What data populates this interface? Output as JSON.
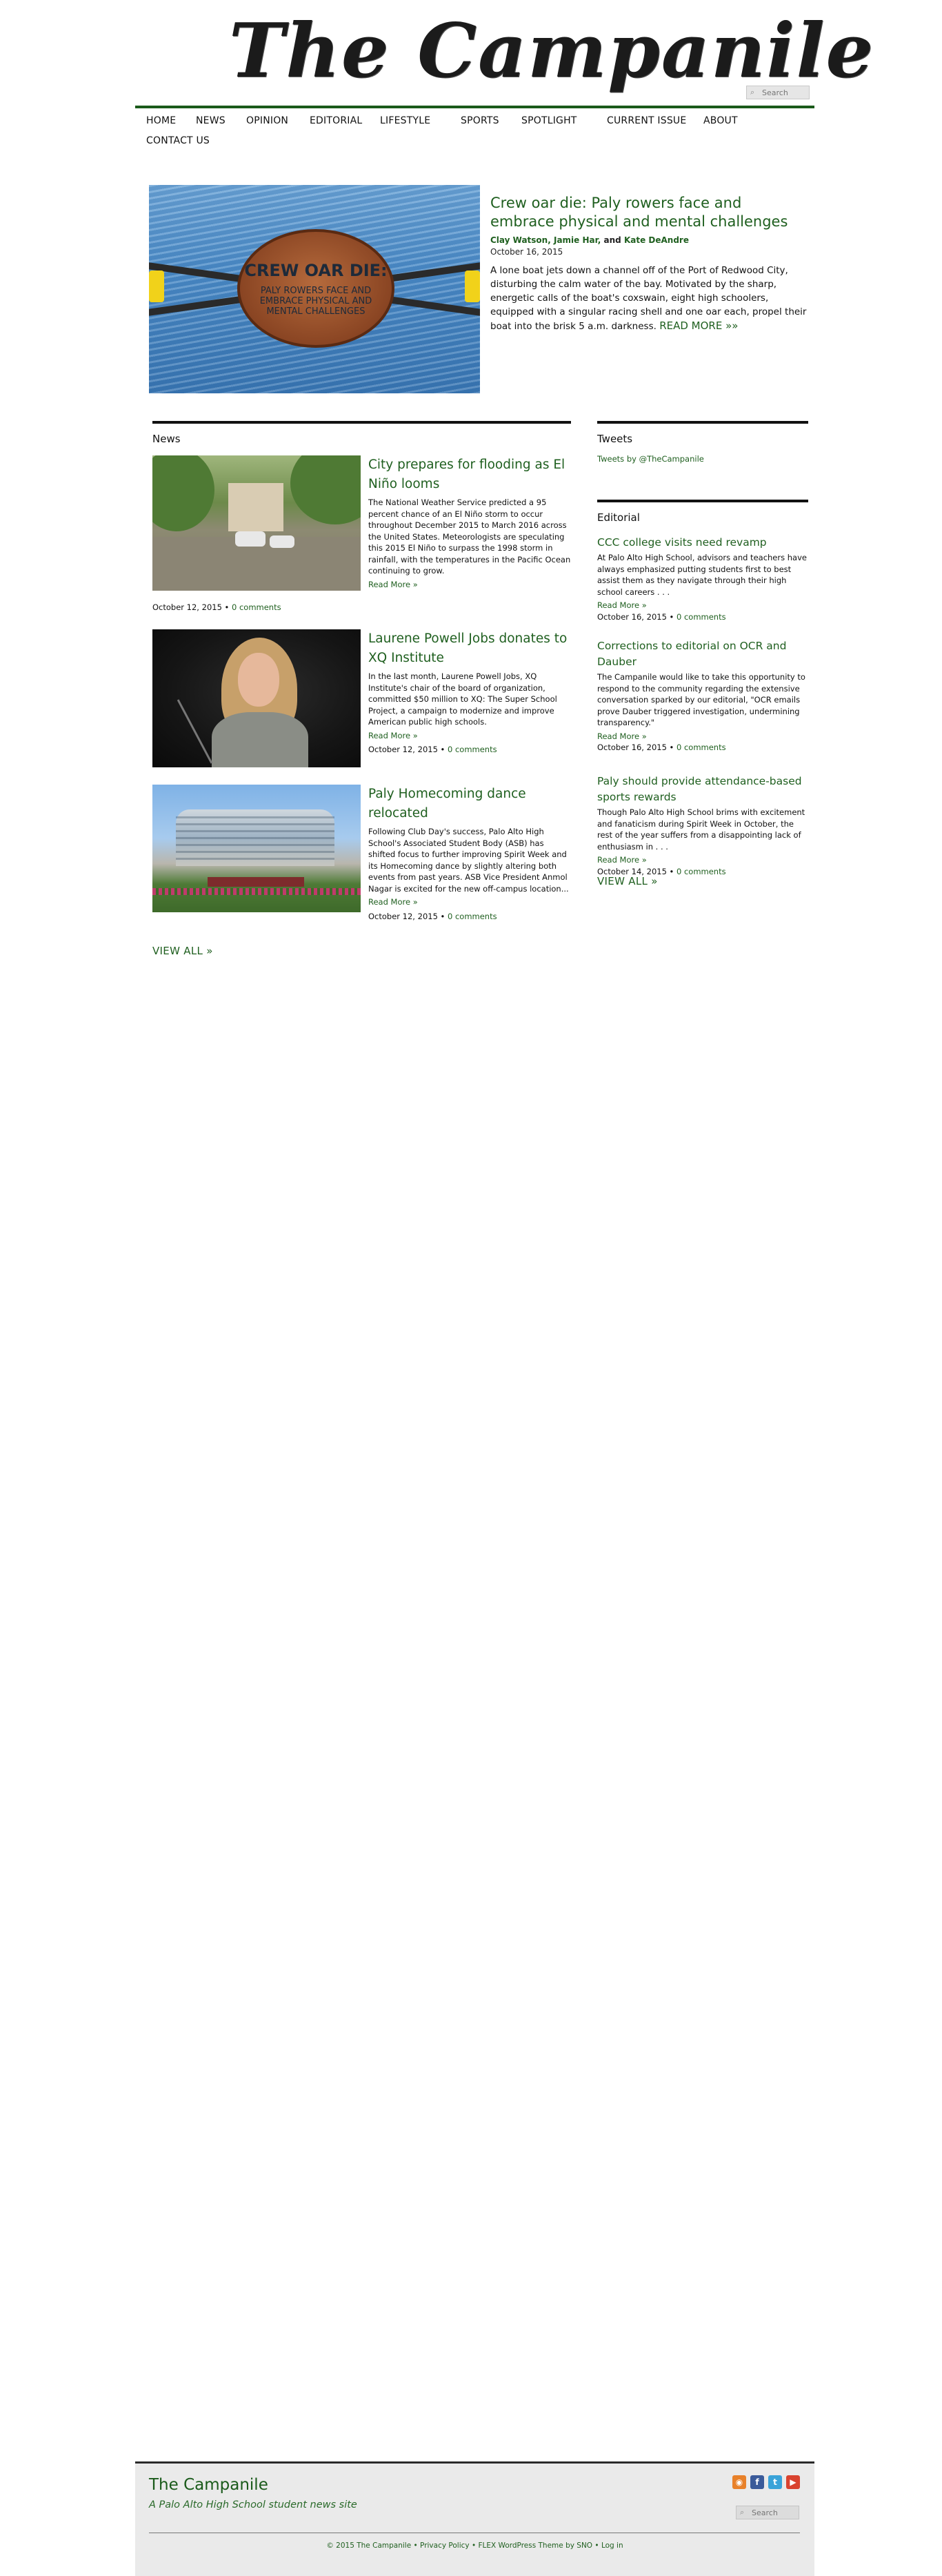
{
  "site": {
    "logo": "The Campanile",
    "search_placeholder": "Search"
  },
  "nav": {
    "items": [
      "HOME",
      "NEWS",
      "OPINION",
      "EDITORIAL",
      "LIFESTYLE",
      "SPORTS",
      "SPOTLIGHT",
      "CURRENT ISSUE",
      "ABOUT",
      "CONTACT US"
    ]
  },
  "feature": {
    "image_headline": "CREW OAR DIE:",
    "image_subhead": "PALY ROWERS FACE AND EMBRACE PHYSICAL AND MENTAL CHALLENGES",
    "title": "Crew oar die: Paly rowers face and embrace physical and mental challenges",
    "author1": "Clay Watson",
    "author2": "Jamie Har",
    "author_and": "and",
    "author3": "Kate DeAndre",
    "date": "October 16, 2015",
    "excerpt": "A lone boat jets down a channel off of the Port of Redwood City, disturbing the calm water of the bay. Motivated by the sharp, energetic calls of the boat's coxswain, eight high schoolers, equipped with a singular racing shell and one oar each, propel their boat into the brisk 5 a.m. darkness.",
    "read_more": "READ MORE »»"
  },
  "news": {
    "heading": "News",
    "items": [
      {
        "title": "City prepares for flooding as El Niño looms",
        "excerpt": "The National Weather Service predicted a 95 percent chance of an El Niño storm to occur throughout December 2015 to March 2016 across the United States. Meteorologists are speculating this 2015 El Niño to surpass the 1998 storm in rainfall, with the temperatures in the Pacific Ocean continuing to grow.",
        "read_more": "Read More »",
        "date": "October 12, 2015",
        "sep": "•",
        "comments": "0 comments"
      },
      {
        "title": "Laurene Powell Jobs donates to XQ Institute",
        "excerpt": "In the last month, Laurene Powell Jobs, XQ Institute's chair of the board of organization, committed $50 million to XQ: The Super School Project, a campaign to modernize and improve American public high schools.",
        "read_more": "Read More »",
        "date": "October 12, 2015",
        "sep": "•",
        "comments": "0 comments"
      },
      {
        "title": "Paly Homecoming dance relocated",
        "excerpt": "Following Club Day's success, Palo Alto High School's Associated Student Body (ASB) has shifted focus to further improving Spirit Week and its Homecoming dance by slightly altering both events from past years. ASB Vice President Anmol Nagar is excited for the new off-campus location...",
        "read_more": "Read More »",
        "date": "October 12, 2015",
        "sep": "•",
        "comments": "0 comments"
      }
    ],
    "view_all": "VIEW ALL »"
  },
  "tweets": {
    "heading": "Tweets",
    "link": "Tweets by @TheCampanile"
  },
  "editorial": {
    "heading": "Editorial",
    "items": [
      {
        "title": "CCC college visits need revamp",
        "excerpt": "At Palo Alto High School, advisors and teachers have always emphasized putting students first to best assist them as they navigate through their high school careers . . .",
        "read_more": "Read More »",
        "date": "October 16, 2015",
        "sep": "•",
        "comments": "0 comments"
      },
      {
        "title": "Corrections to editorial on OCR and Dauber",
        "excerpt": "The Campanile would like to take this opportunity to respond to the community regarding the extensive conversation sparked by our editorial, \"OCR emails prove Dauber triggered investigation, undermining transparency.\"",
        "read_more": "Read More »",
        "date": "October 16, 2015",
        "sep": "•",
        "comments": "0 comments"
      },
      {
        "title": "Paly should provide attendance-based sports rewards",
        "excerpt": "Though Palo Alto High School brims with excitement and fanaticism during Spirit Week in October, the rest of the year suffers from a disappointing lack of enthusiasm in . . .",
        "read_more": "Read More »",
        "date": "October 14, 2015",
        "sep": "•",
        "comments": "0 comments"
      }
    ],
    "view_all": "VIEW ALL »"
  },
  "footer": {
    "title": "The Campanile",
    "tagline": "A Palo Alto High School student news site",
    "search_placeholder": "Search",
    "copyright": "© 2015 The Campanile",
    "sep": "•",
    "privacy": "Privacy Policy",
    "theme": "FLEX WordPress Theme by SNO",
    "login": "Log in",
    "social": {
      "rss_color": "#e8812a",
      "facebook_color": "#3b5b9a",
      "twitter_color": "#3aa3d9",
      "youtube_color": "#d9432f"
    }
  }
}
